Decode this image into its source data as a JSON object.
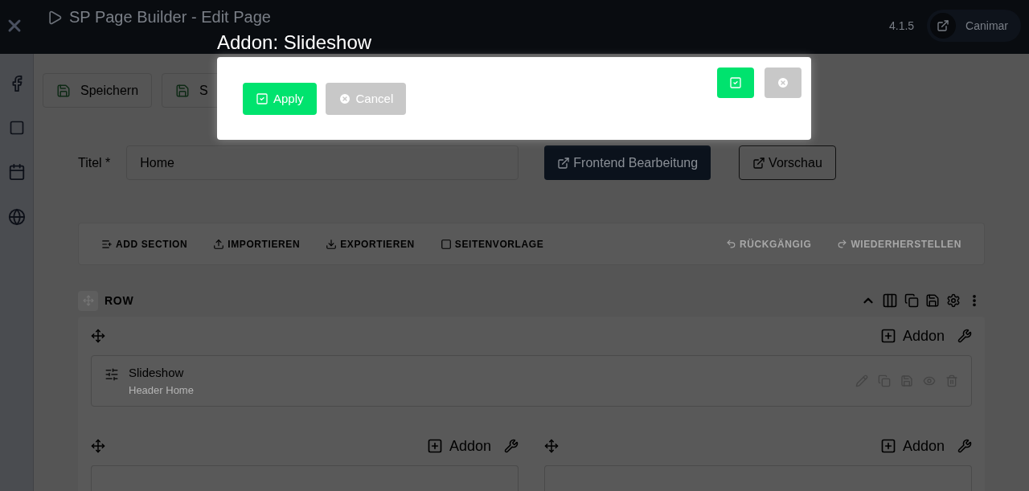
{
  "header": {
    "title": "SP Page Builder - Edit Page",
    "version": "4.1.5",
    "user": "Canimar"
  },
  "toolbar": {
    "buttons": [
      "Speichern",
      "S"
    ]
  },
  "form": {
    "label": "Titel *",
    "value": "Home",
    "buttons": [
      {
        "label": "Frontend Bearbeitung",
        "kind": "primary"
      },
      {
        "label": "Vorschau",
        "kind": "outline"
      }
    ]
  },
  "builder_toolbar": {
    "actions": [
      {
        "label": "ADD SECTION",
        "disabled": false
      },
      {
        "label": "IMPORTIEREN",
        "disabled": false
      },
      {
        "label": "EXPORTIEREN",
        "disabled": false
      },
      {
        "label": "SEITENVORLAGE",
        "disabled": false
      }
    ],
    "history": [
      {
        "label": "RÜCKGÄNGIG",
        "disabled": true
      },
      {
        "label": "WIEDERHERSTELLEN",
        "disabled": true
      }
    ]
  },
  "row": {
    "label": "ROW",
    "columns": [
      {
        "add_label": "Addon",
        "addons": [
          {
            "title": "Slideshow",
            "subtitle": "Header Home"
          }
        ]
      },
      {
        "add_label": "Addon"
      },
      {
        "add_label": "Addon"
      }
    ]
  },
  "modal": {
    "title": "Addon: Slideshow",
    "buttons": [
      {
        "label": "Apply",
        "kind": "apply"
      },
      {
        "label": "Cancel",
        "kind": "cancel"
      }
    ],
    "corner_buttons": [
      {
        "kind": "apply"
      },
      {
        "kind": "cancel"
      }
    ]
  }
}
